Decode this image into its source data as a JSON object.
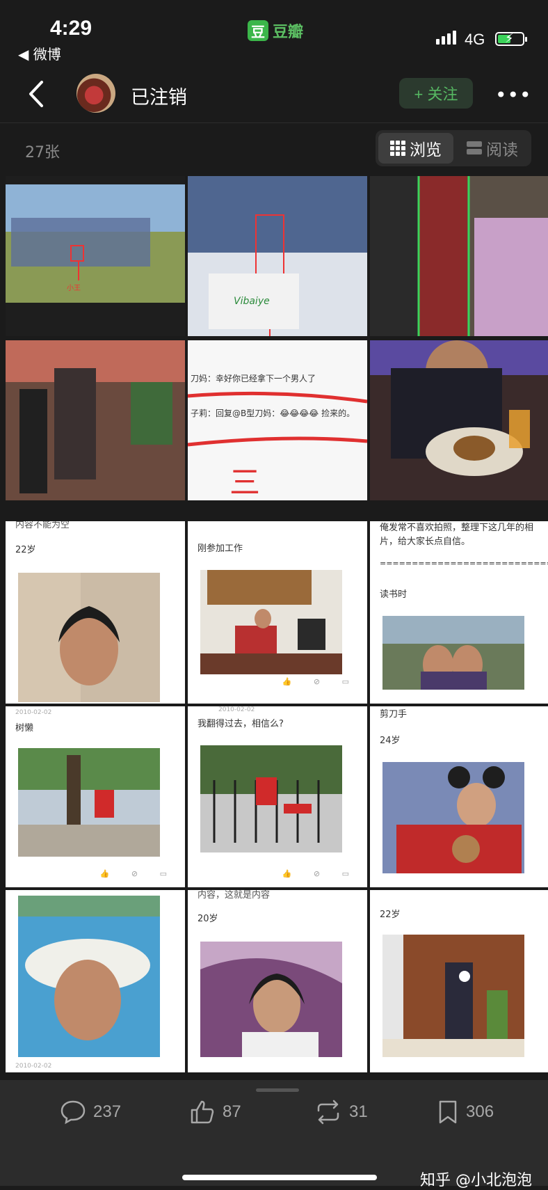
{
  "status": {
    "time": "4:29",
    "back_app": "◀ 微博",
    "app_name": "豆瓣",
    "app_logo": "豆",
    "network": "4G"
  },
  "nav": {
    "title": "已注销",
    "follow": "+ 关注",
    "more": "•••"
  },
  "album": {
    "count": "27张",
    "browse": "浏览",
    "read": "阅读"
  },
  "tiles": {
    "chat_line1": "刀妈：幸好你已经拿下一个男人了",
    "chat_line2": "子莉：回复@B型刀妈：😂😂😂😂 捡来的。",
    "handwrite": "三",
    "group_caption": "小王",
    "banner_text": "Vibaiye",
    "t7_top": "内容不能为空",
    "t7_age": "22岁",
    "t8_text": "刚参加工作",
    "t9_line1": "俺发常不喜欢拍照，整理下这几年的相",
    "t9_line2": "片，给大家长点自信。",
    "t9_sep": "=============================",
    "t9_label": "读书时",
    "t10_date": "2010-02-02",
    "t10_text": "树懒",
    "t11_date": "2010-02-02",
    "t11_text": "我翻得过去，相信么?",
    "t12_text": "剪刀手",
    "t12_age": "24岁",
    "t14_top": "内容，这就是内容",
    "t14_age": "20岁",
    "t15_age": "22岁",
    "t16_date": "2010-02-02"
  },
  "actions": {
    "comments": "237",
    "likes": "87",
    "reshares": "31",
    "saves": "306"
  },
  "watermark": "知乎 @小北泡泡",
  "colors": {
    "accent": "#56b862",
    "background": "#1b1b1b",
    "bottom_bar": "#2c2c2c"
  }
}
